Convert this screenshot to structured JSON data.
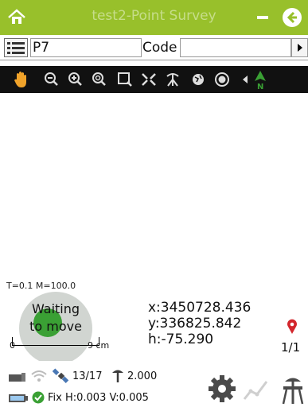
{
  "titlebar": {
    "title": "test2-Point Survey"
  },
  "input": {
    "point_name": "P7",
    "code_label": "Code",
    "code_value": ""
  },
  "toolbar": {
    "icons": [
      "hand-icon",
      "zoom-out-icon",
      "zoom-in-icon",
      "zoom-extent-icon",
      "zoom-window-icon",
      "pan-fit-icon",
      "station-icon",
      "globe-icon",
      "target-icon",
      "north-arrow-icon"
    ]
  },
  "map": {
    "scale_info": "T=0.1 M=100.0",
    "waiting_line1": "Waiting",
    "waiting_line2": "to move",
    "scale_zero": "0",
    "scale_length": "9 cm",
    "x": "x:3450728.436",
    "y": "y:336825.842",
    "h": "h:-75.290",
    "page": "1/1"
  },
  "status": {
    "satellites": "13/17",
    "antenna_height": "2.000",
    "fix": "Fix H:0.003 V:0.005"
  },
  "colors": {
    "brand_green": "#98c02b",
    "toolbar_bg": "#111111"
  }
}
